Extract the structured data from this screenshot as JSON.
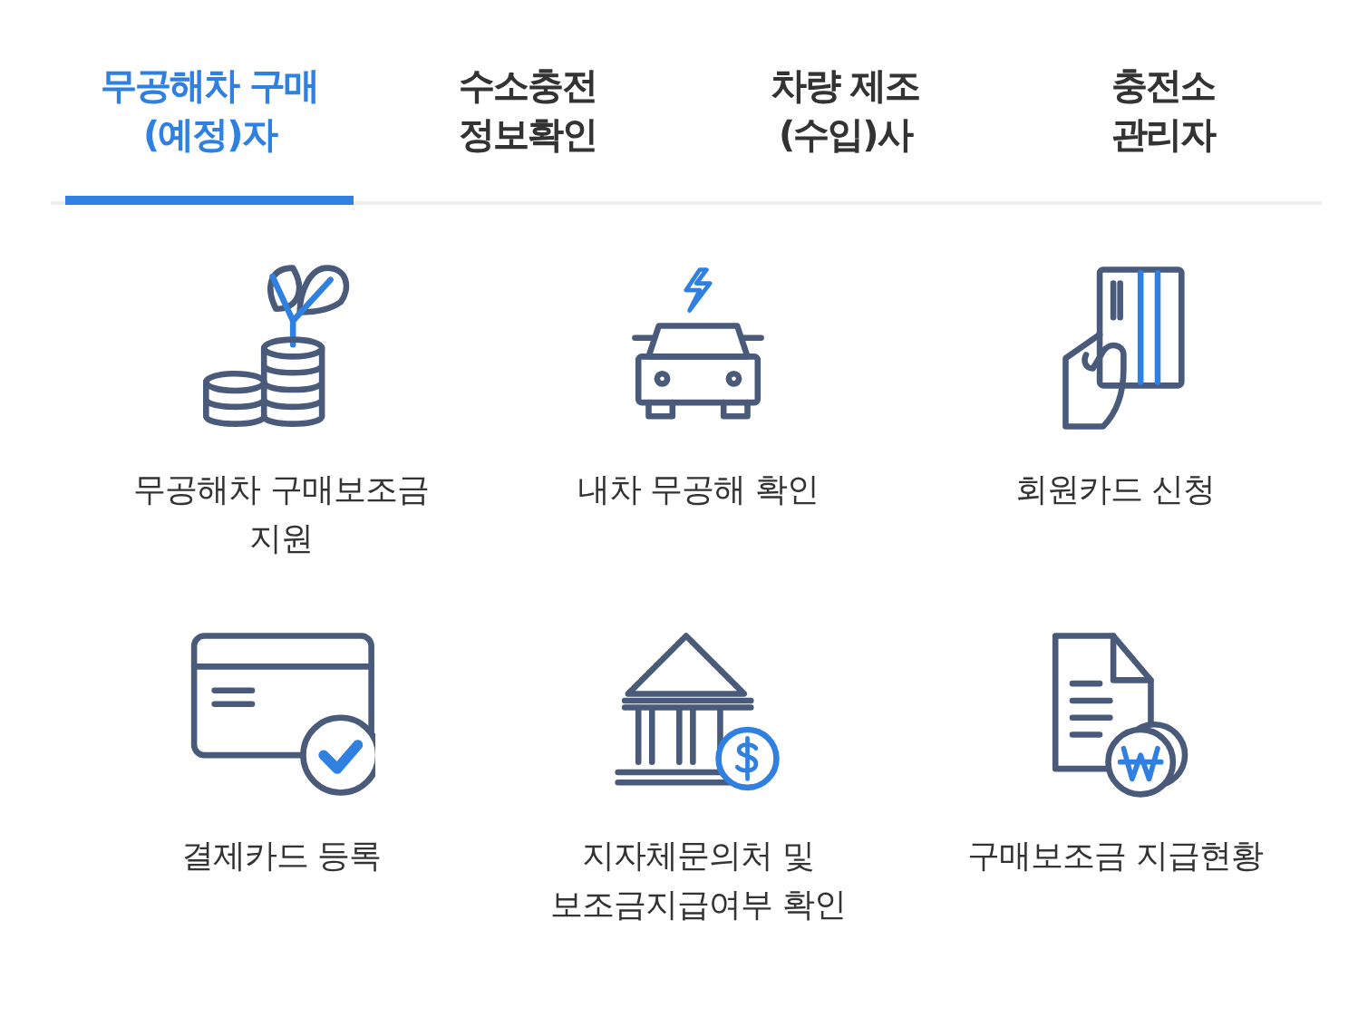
{
  "tabs": [
    {
      "label": "무공해차 구매\n(예정)자",
      "selected": true
    },
    {
      "label": "수소충전\n정보확인",
      "selected": false
    },
    {
      "label": "차량 제조\n(수입)사",
      "selected": false
    },
    {
      "label": "충전소\n관리자",
      "selected": false
    }
  ],
  "menu_items": [
    {
      "label": "무공해차 구매보조금\n지원"
    },
    {
      "label": "내차 무공해 확인"
    },
    {
      "label": "회원카드 신청"
    },
    {
      "label": "결제카드 등록"
    },
    {
      "label": "지자체문의처 및\n보조금지급여부 확인"
    },
    {
      "label": "구매보조금 지급현황"
    }
  ]
}
